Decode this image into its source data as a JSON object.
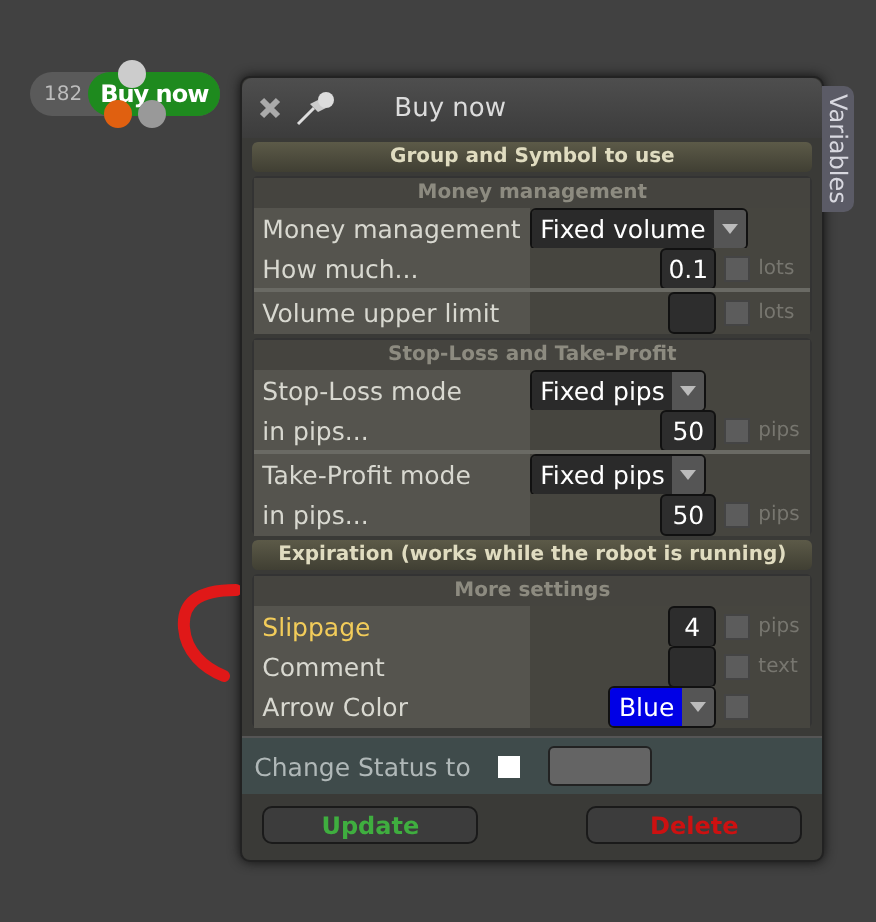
{
  "node": {
    "count": "182",
    "label": "Buy now"
  },
  "window": {
    "title": "Buy now",
    "side_tab": "Variables"
  },
  "sections": [
    {
      "kind": "bar",
      "title": "Group and Symbol to use"
    },
    {
      "kind": "group",
      "title": "Money management",
      "blocks": [
        [
          {
            "label": "Money management",
            "kind": "select",
            "value": "Fixed volume",
            "highlighted": false
          },
          {
            "label": "How much...",
            "kind": "number",
            "value": "0.1",
            "unit": "lots",
            "checked": false,
            "highlighted": false
          }
        ],
        [
          {
            "label": "Volume upper limit",
            "kind": "number",
            "unit": "lots",
            "checked": false,
            "highlighted": false
          }
        ]
      ]
    },
    {
      "kind": "group",
      "title": "Stop-Loss and Take-Profit",
      "blocks": [
        [
          {
            "label": "Stop-Loss mode",
            "kind": "select",
            "value": "Fixed pips",
            "highlighted": false
          },
          {
            "label": "in pips...",
            "kind": "number",
            "value": "50",
            "unit": "pips",
            "checked": false,
            "highlighted": false
          }
        ],
        [
          {
            "label": "Take-Profit mode",
            "kind": "select",
            "value": "Fixed pips",
            "highlighted": false
          },
          {
            "label": "in pips...",
            "kind": "number",
            "value": "50",
            "unit": "pips",
            "checked": false,
            "highlighted": false
          }
        ]
      ]
    },
    {
      "kind": "bar",
      "title": "Expiration (works while the robot is running)"
    },
    {
      "kind": "group",
      "title": "More settings",
      "blocks": [
        [
          {
            "label": "Slippage",
            "kind": "number",
            "value": "4",
            "unit": "pips",
            "checked": false,
            "highlighted": true
          },
          {
            "label": "Comment",
            "kind": "number",
            "unit": "text",
            "checked": false,
            "highlighted": false
          },
          {
            "label": "Arrow Color",
            "kind": "color-select",
            "value": "Blue",
            "checked": false,
            "highlighted": false
          }
        ]
      ]
    }
  ],
  "status": {
    "label": "Change Status to",
    "checked": false
  },
  "buttons": [
    {
      "label": "Update",
      "kind": "update"
    },
    {
      "label": "Delete",
      "kind": "delete"
    }
  ]
}
